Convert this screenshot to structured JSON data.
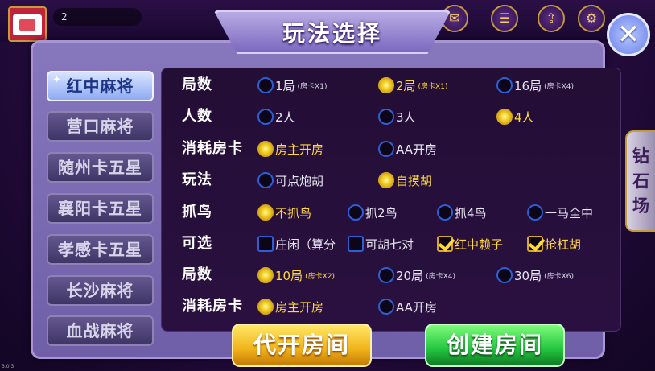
{
  "header": {
    "user_id": "2",
    "close_glyph": "✕",
    "top_icons": [
      "mail-icon",
      "menu-icon",
      "share-icon",
      "settings-icon"
    ],
    "side_tab": [
      "钻",
      "石",
      "场"
    ]
  },
  "dialog": {
    "title": "玩法选择"
  },
  "rules": {
    "items": [
      {
        "label": "红中麻将",
        "active": true
      },
      {
        "label": "营口麻将"
      },
      {
        "label": "随州卡五星"
      },
      {
        "label": "襄阳卡五星"
      },
      {
        "label": "孝感卡五星"
      },
      {
        "label": "长沙麻将"
      },
      {
        "label": "血战麻将"
      }
    ]
  },
  "options": {
    "rounds_label": "局数",
    "rounds": [
      {
        "text": "1局",
        "sub": "(房卡X1)"
      },
      {
        "text": "2局",
        "sub": "(房卡X1)",
        "selected": true
      },
      {
        "text": "16局",
        "sub": "(房卡X4)"
      }
    ],
    "players_label": "人数",
    "players": [
      {
        "text": "2人"
      },
      {
        "text": "3人"
      },
      {
        "text": "4人",
        "selected": true
      }
    ],
    "cost_label": "消耗房卡",
    "cost": [
      {
        "text": "房主开房",
        "selected": true
      },
      {
        "text": "AA开房"
      }
    ],
    "play_label": "玩法",
    "play": [
      {
        "text": "可点炮胡"
      },
      {
        "text": "自摸胡",
        "selected": true
      }
    ],
    "birds_label": "抓鸟",
    "birds": [
      {
        "text": "不抓鸟",
        "selected": true
      },
      {
        "text": "抓2鸟"
      },
      {
        "text": "抓4鸟"
      },
      {
        "text": "一马全中"
      }
    ],
    "extras_label": "可选",
    "extras": [
      {
        "text": "庄闲（算分"
      },
      {
        "text": "可胡七对"
      },
      {
        "text": "红中赖子",
        "checked": true
      },
      {
        "text": "抢杠胡",
        "checked": true
      }
    ],
    "rounds2_label": "局数",
    "rounds2": [
      {
        "text": "10局",
        "sub": "(房卡X2)",
        "selected": true
      },
      {
        "text": "20局",
        "sub": "(房卡X4)"
      },
      {
        "text": "30局",
        "sub": "(房卡X6)"
      }
    ],
    "cost2_label": "消耗房卡",
    "cost2": [
      {
        "text": "房主开房",
        "selected": true
      },
      {
        "text": "AA开房"
      }
    ]
  },
  "buttons": {
    "proxy_room": "代开房间",
    "create_room": "创建房间"
  },
  "footer": {
    "version": "3.0.3"
  }
}
